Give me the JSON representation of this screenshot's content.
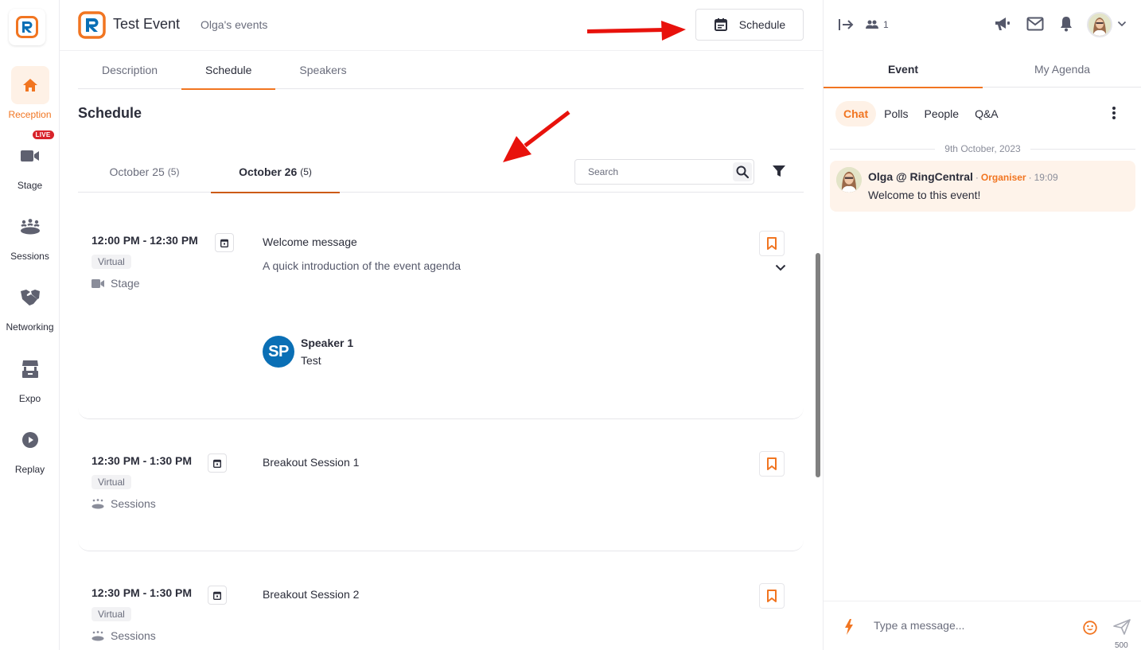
{
  "colors": {
    "accent": "#f17521",
    "text": "#2b2d3a",
    "muted": "#6a6d7c",
    "live": "#d8232a",
    "speaker_avatar": "#0a6fb5",
    "message_bg": "#fef3ea"
  },
  "sidebar": {
    "logo": "ringcentral-logo",
    "items": [
      {
        "label": "Reception",
        "icon": "home-icon",
        "active": true
      },
      {
        "label": "Stage",
        "icon": "video-camera-icon",
        "badge": "LIVE"
      },
      {
        "label": "Sessions",
        "icon": "people-group-icon"
      },
      {
        "label": "Networking",
        "icon": "handshake-icon"
      },
      {
        "label": "Expo",
        "icon": "booth-icon"
      },
      {
        "label": "Replay",
        "icon": "play-circle-icon"
      }
    ]
  },
  "header": {
    "title": "Test Event",
    "organizer": "Olga's events",
    "schedule_button": "Schedule"
  },
  "tabs": [
    {
      "label": "Description"
    },
    {
      "label": "Schedule",
      "active": true
    },
    {
      "label": "Speakers"
    }
  ],
  "schedule": {
    "title": "Schedule",
    "date_tabs": [
      {
        "label": "October 25",
        "count": "(5)"
      },
      {
        "label": "October 26",
        "count": "(5)",
        "active": true
      }
    ],
    "search_placeholder": "Search",
    "sessions": [
      {
        "time": "12:00 PM - 12:30 PM",
        "tag": "Virtual",
        "location": "Stage",
        "location_icon": "video-camera-icon",
        "title": "Welcome message",
        "description": "A quick introduction of the event agenda",
        "speaker": {
          "initials": "SP",
          "name": "Speaker 1",
          "role": "Test"
        }
      },
      {
        "time": "12:30 PM - 1:30 PM",
        "tag": "Virtual",
        "location": "Sessions",
        "location_icon": "people-group-icon",
        "title": "Breakout Session 1"
      },
      {
        "time": "12:30 PM - 1:30 PM",
        "tag": "Virtual",
        "location": "Sessions",
        "location_icon": "people-group-icon",
        "title": "Breakout Session 2"
      }
    ]
  },
  "right_panel": {
    "attendee_count": "1",
    "tabs": [
      {
        "label": "Event",
        "active": true
      },
      {
        "label": "My Agenda"
      }
    ],
    "sub_tabs": [
      {
        "label": "Chat",
        "active": true
      },
      {
        "label": "Polls"
      },
      {
        "label": "People"
      },
      {
        "label": "Q&A"
      }
    ],
    "date_separator": "9th October, 2023",
    "messages": [
      {
        "author": "Olga @ RingCentral",
        "role": "Organiser",
        "time": "19:09",
        "text": "Welcome to this event!"
      }
    ],
    "composer": {
      "placeholder": "Type a message...",
      "char_limit": "500"
    }
  }
}
